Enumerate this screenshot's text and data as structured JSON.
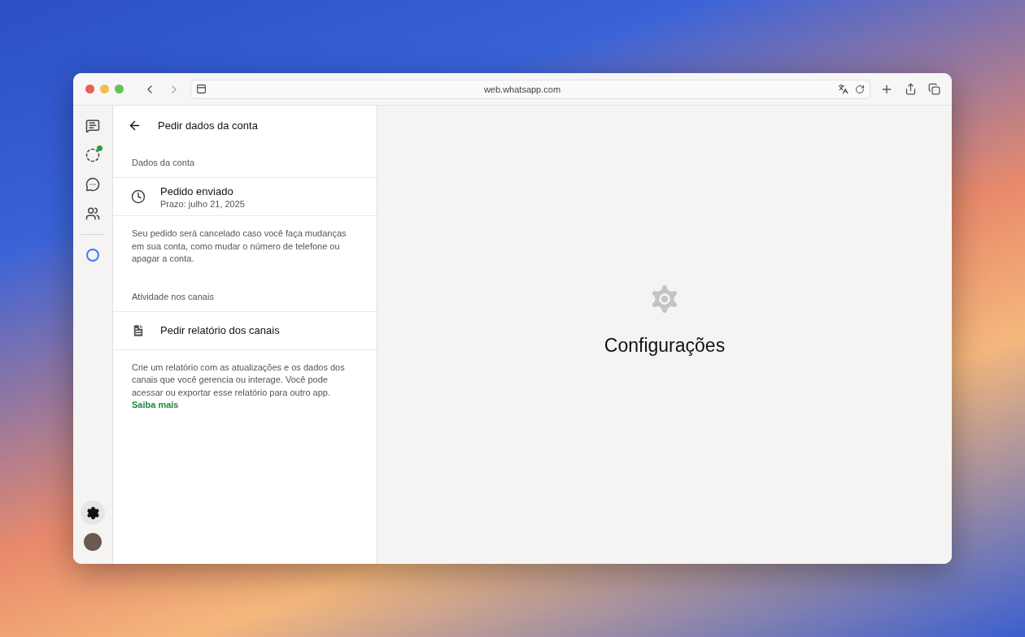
{
  "browser": {
    "url": "web.whatsapp.com"
  },
  "sidebar": {
    "items": [
      {
        "kind": "chats",
        "selected": false,
        "unread": false
      },
      {
        "kind": "status",
        "selected": false,
        "unread": true
      },
      {
        "kind": "channels",
        "selected": false,
        "unread": false
      },
      {
        "kind": "communities",
        "selected": false,
        "unread": false
      },
      {
        "kind": "ai",
        "selected": false,
        "unread": false
      }
    ],
    "bottom": [
      {
        "kind": "settings",
        "selected": true
      },
      {
        "kind": "profile",
        "selected": false
      }
    ]
  },
  "panel": {
    "title": "Pedir dados da conta",
    "sections": [
      {
        "heading": "Dados da conta",
        "row": {
          "kind": "clock",
          "title": "Pedido enviado",
          "subtitle": "Prazo: julho 21, 2025"
        },
        "note": "Seu pedido será cancelado caso você faça mudanças em sua conta, como mudar o número de telefone ou apagar a conta."
      },
      {
        "heading": "Atividade nos canais",
        "row": {
          "kind": "document",
          "title": "Pedir relatório dos canais"
        },
        "note": "Crie um relatório com as atualizações e os dados dos canais que você gerencia ou interage. Você pode acessar ou exportar esse relatório para outro app.",
        "link": "Saiba mais"
      }
    ]
  },
  "main": {
    "title": "Configurações"
  }
}
